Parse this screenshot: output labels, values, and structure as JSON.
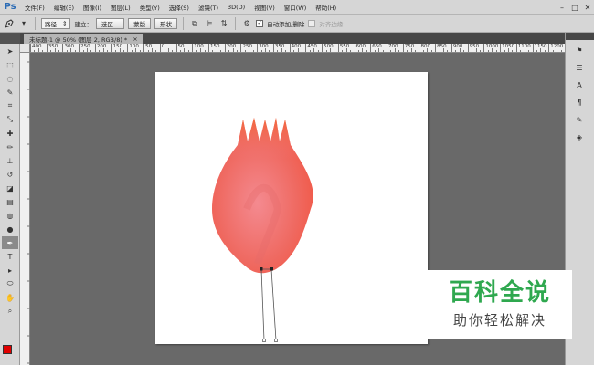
{
  "app": {
    "logo": "Ps"
  },
  "menu": [
    "文件(F)",
    "编辑(E)",
    "图像(I)",
    "图层(L)",
    "类型(Y)",
    "选择(S)",
    "滤镜(T)",
    "3D(D)",
    "视图(V)",
    "窗口(W)",
    "帮助(H)"
  ],
  "window_controls": {
    "minimize": "–",
    "maximize": "□",
    "close": "✕"
  },
  "options": {
    "mode": "路径",
    "make_label": "建立：",
    "selection_btn": "选区...",
    "mask_btn": "蒙版",
    "shape_btn": "形状",
    "auto_add_delete": "自动添加/删除",
    "auto_add_delete_checked": true,
    "align_edges": "对齐边缘",
    "align_edges_checked": false
  },
  "tab": {
    "title": "未标题-1 @ 50% (图层 2, RGB/8) *",
    "close": "×"
  },
  "ruler_labels": [
    "400",
    "350",
    "300",
    "250",
    "200",
    "150",
    "100",
    "50",
    "0",
    "50",
    "100",
    "150",
    "200",
    "250",
    "300",
    "350",
    "400",
    "450",
    "500",
    "550",
    "600",
    "650",
    "700",
    "750",
    "800",
    "850",
    "900",
    "950",
    "1000",
    "1050",
    "1100",
    "1150",
    "1200"
  ],
  "colors": {
    "foreground": "#e00000",
    "background": "#ffffff",
    "workspace": "#696969",
    "watermark_green": "#2fa84f"
  },
  "watermark": {
    "title": "百科全说",
    "subtitle": "助你轻松解决"
  }
}
